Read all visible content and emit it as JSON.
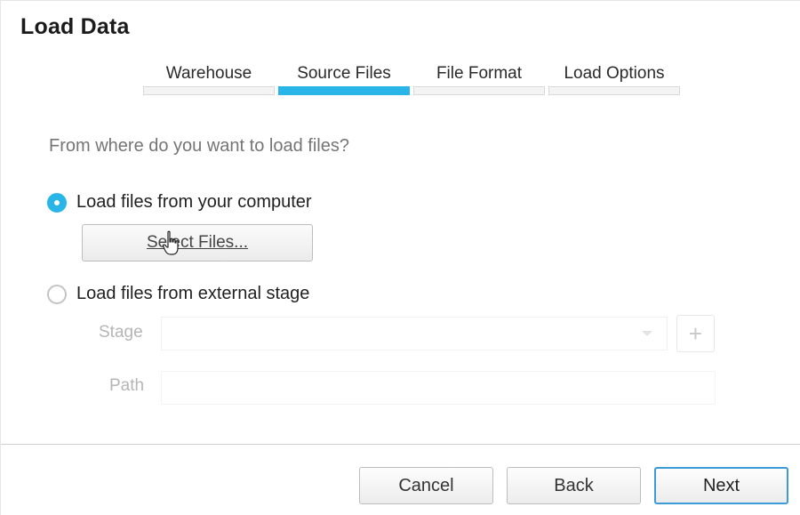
{
  "dialog": {
    "title": "Load Data"
  },
  "tabs": [
    {
      "label": "Warehouse",
      "active": false
    },
    {
      "label": "Source Files",
      "active": true
    },
    {
      "label": "File Format",
      "active": false
    },
    {
      "label": "Load Options",
      "active": false
    }
  ],
  "source": {
    "question": "From where do you want to load files?",
    "option_computer": "Load files from your computer",
    "select_files_label": "Select Files...",
    "option_external": "Load files from external stage",
    "selected_option": "computer",
    "stage_label": "Stage",
    "stage_value": "",
    "add_stage_icon": "+",
    "path_label": "Path",
    "path_value": ""
  },
  "footer": {
    "cancel_label": "Cancel",
    "back_label": "Back",
    "next_label": "Next"
  },
  "colors": {
    "accent": "#29b5e8",
    "primary_button_border": "#3c9ad6"
  }
}
